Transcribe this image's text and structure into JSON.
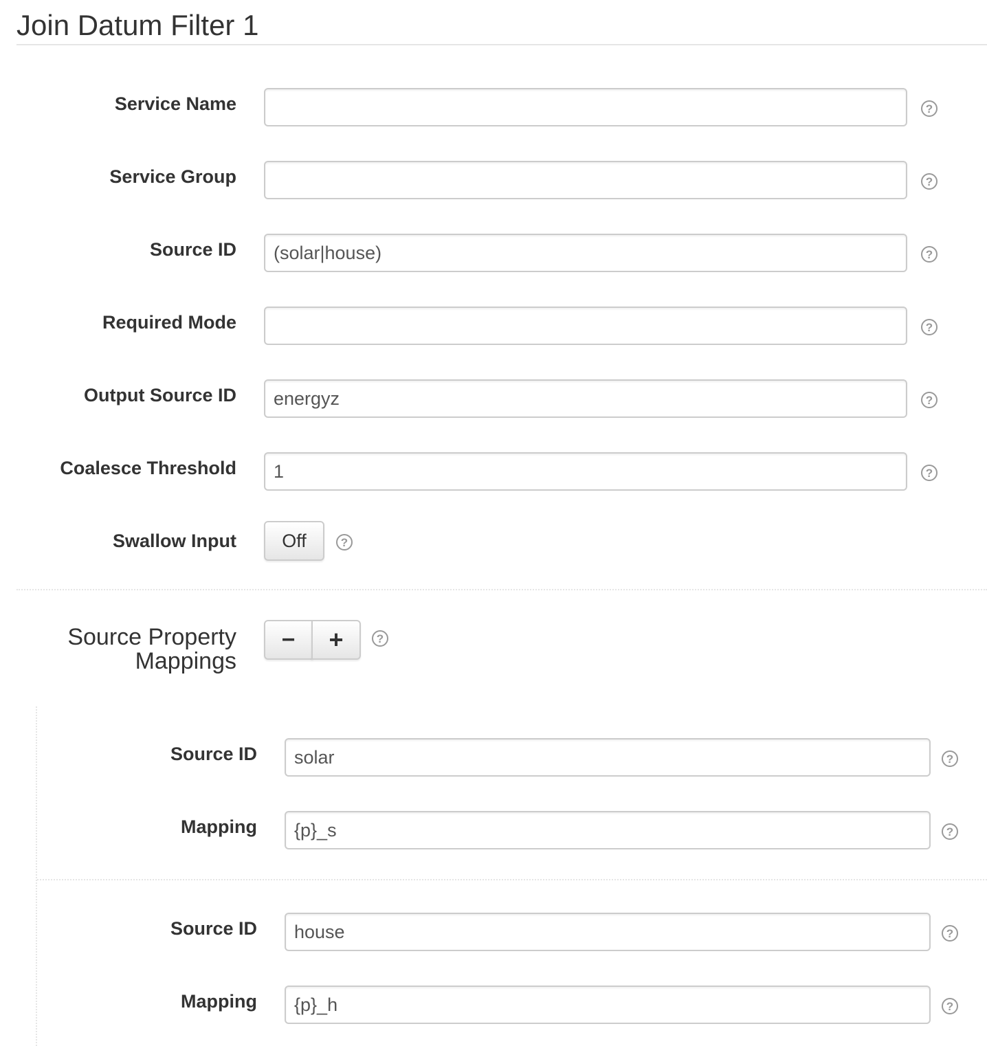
{
  "title": "Join Datum Filter 1",
  "fields": [
    {
      "label": "Service Name",
      "value": ""
    },
    {
      "label": "Service Group",
      "value": ""
    },
    {
      "label": "Source ID",
      "value": "(solar|house)"
    },
    {
      "label": "Required Mode",
      "value": ""
    },
    {
      "label": "Output Source ID",
      "value": "energyz"
    },
    {
      "label": "Coalesce Threshold",
      "value": "1"
    }
  ],
  "swallow_input": {
    "label": "Swallow Input",
    "toggle_label": "Off"
  },
  "mappings_section": {
    "label_line1": "Source Property",
    "label_line2": "Mappings",
    "remove_label": "−",
    "add_label": "+"
  },
  "mappings": [
    {
      "source_id_label": "Source ID",
      "source_id": "solar",
      "mapping_label": "Mapping",
      "mapping": "{p}_s"
    },
    {
      "source_id_label": "Source ID",
      "source_id": "house",
      "mapping_label": "Mapping",
      "mapping": "{p}_h"
    }
  ],
  "help_glyph": "?"
}
